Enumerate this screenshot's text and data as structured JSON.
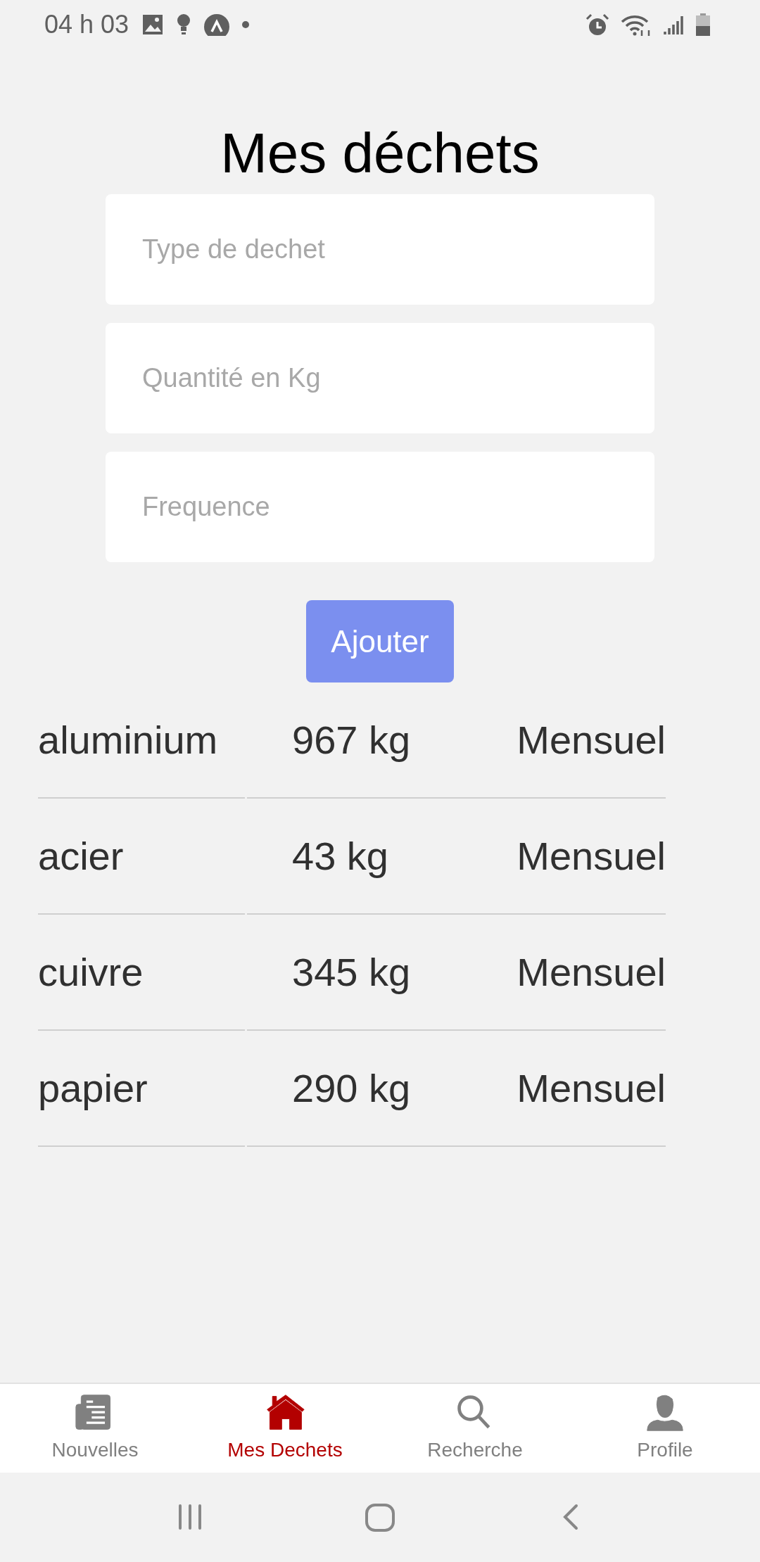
{
  "status_bar": {
    "time": "04 h 03"
  },
  "title": "Mes déchets",
  "form": {
    "fields": [
      {
        "placeholder": "Type de dechet"
      },
      {
        "placeholder": "Quantité en Kg"
      },
      {
        "placeholder": "Frequence"
      }
    ],
    "button": "Ajouter"
  },
  "waste_list": [
    {
      "type": "aluminium",
      "quantity": "967 kg",
      "frequency": "Mensuel"
    },
    {
      "type": "acier",
      "quantity": "43 kg",
      "frequency": "Mensuel"
    },
    {
      "type": "cuivre",
      "quantity": "345 kg",
      "frequency": "Mensuel"
    },
    {
      "type": "papier",
      "quantity": "290 kg",
      "frequency": "Mensuel"
    }
  ],
  "tabs": [
    {
      "kind": "news",
      "label": "Nouvelles",
      "selected": false
    },
    {
      "kind": "home",
      "label": "Mes Dechets",
      "selected": true
    },
    {
      "kind": "search",
      "label": "Recherche",
      "selected": false
    },
    {
      "kind": "profile",
      "label": "Profile",
      "selected": false
    }
  ]
}
